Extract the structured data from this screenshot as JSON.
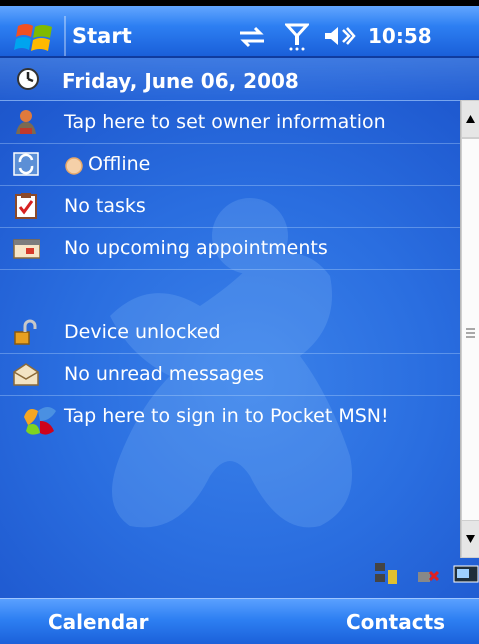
{
  "titlebar": {
    "start_label": "Start",
    "time": "10:58",
    "icons": [
      "windows-logo-icon",
      "connectivity-icon",
      "signal-icon",
      "volume-icon"
    ]
  },
  "today": {
    "date": "Friday, June 06, 2008",
    "items": [
      {
        "icon": "owner-icon",
        "label": "Tap here to set owner information"
      },
      {
        "icon": "sync-icon",
        "label": "Offline"
      },
      {
        "icon": "tasks-icon",
        "label": "No tasks"
      },
      {
        "icon": "calendar-icon",
        "label": "No upcoming appointments"
      },
      {
        "icon": "lock-icon",
        "label": "Device unlocked"
      },
      {
        "icon": "mail-icon",
        "label": "No unread messages"
      },
      {
        "icon": "msn-icon",
        "label": "Tap here to sign in to Pocket MSN!"
      }
    ]
  },
  "tray_icons": [
    "network-icon",
    "no-connection-icon",
    "keyboard-icon"
  ],
  "menubar": {
    "left_softkey": "Calendar",
    "right_softkey": "Contacts"
  }
}
